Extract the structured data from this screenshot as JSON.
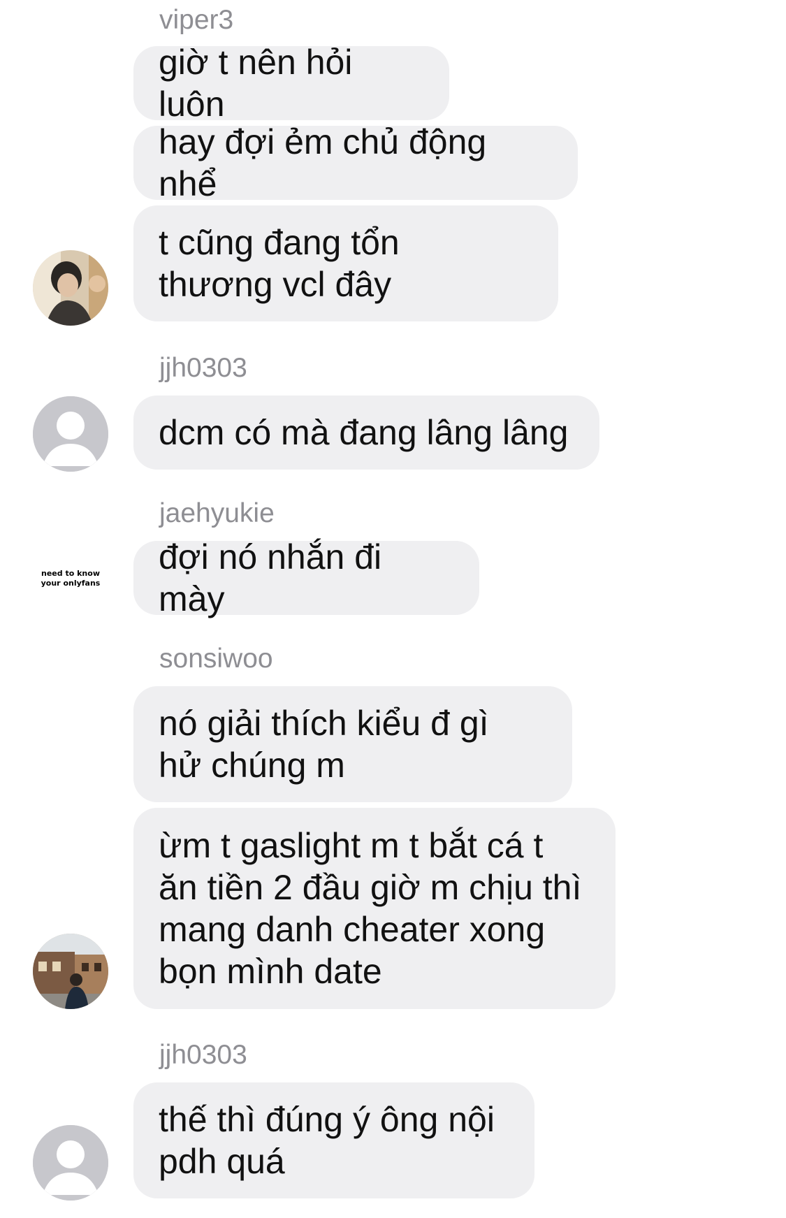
{
  "thread": {
    "groups": [
      {
        "sender": "viper3",
        "messages": [
          "giờ t nên hỏi luôn",
          "hay đợi ẻm chủ động nhể",
          "t cũng đang tổn thương vcl đây"
        ]
      },
      {
        "sender": "jjh0303",
        "messages": [
          "dcm có mà đang lâng lâng"
        ]
      },
      {
        "sender": "jaehyukie",
        "avatar_text": [
          "need to know",
          "your onlyfans"
        ],
        "messages": [
          "đợi nó nhắn đi mày"
        ]
      },
      {
        "sender": "sonsiwoo",
        "messages": [
          "nó giải thích kiểu đ gì hử chúng m",
          "ừm t gaslight m t bắt cá t ăn tiền 2 đầu giờ m chịu thì mang danh cheater xong bọn mình date"
        ]
      },
      {
        "sender": "jjh0303",
        "messages": [
          "thế thì đúng ý ông nội pdh quá"
        ]
      }
    ]
  },
  "colors": {
    "bubble_bg": "#efeff1",
    "sender_text": "#8e8e93",
    "message_text": "#111111",
    "default_avatar_bg": "#c7c7cc"
  },
  "icons": {
    "default_avatar": "person-silhouette-icon"
  }
}
